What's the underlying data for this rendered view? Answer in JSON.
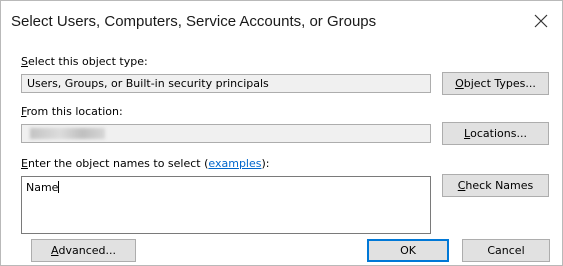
{
  "window": {
    "title": "Select Users, Computers, Service Accounts, or Groups",
    "close_icon": "close-icon"
  },
  "object_type": {
    "label_prefix": "S",
    "label_rest": "elect this object type:",
    "value": "Users, Groups, or Built-in security principals",
    "button_prefix": "O",
    "button_rest": "bject Types..."
  },
  "location": {
    "label_prefix": "F",
    "label_rest": "rom this location:",
    "value": "",
    "button_prefix": "L",
    "button_rest": "ocations..."
  },
  "names": {
    "label_prefix": "E",
    "label_rest": "nter the object names to select (",
    "examples_link": "examples",
    "label_suffix": "):",
    "value": "Name",
    "check_button_prefix": "C",
    "check_button_rest": "heck Names"
  },
  "footer": {
    "advanced_prefix": "A",
    "advanced_rest": "dvanced...",
    "ok_label": "OK",
    "cancel_label": "Cancel"
  },
  "colors": {
    "accent": "#0078d7",
    "link": "#0066cc",
    "button_face": "#e1e1e1",
    "readonly_field": "#f0f0f0"
  }
}
